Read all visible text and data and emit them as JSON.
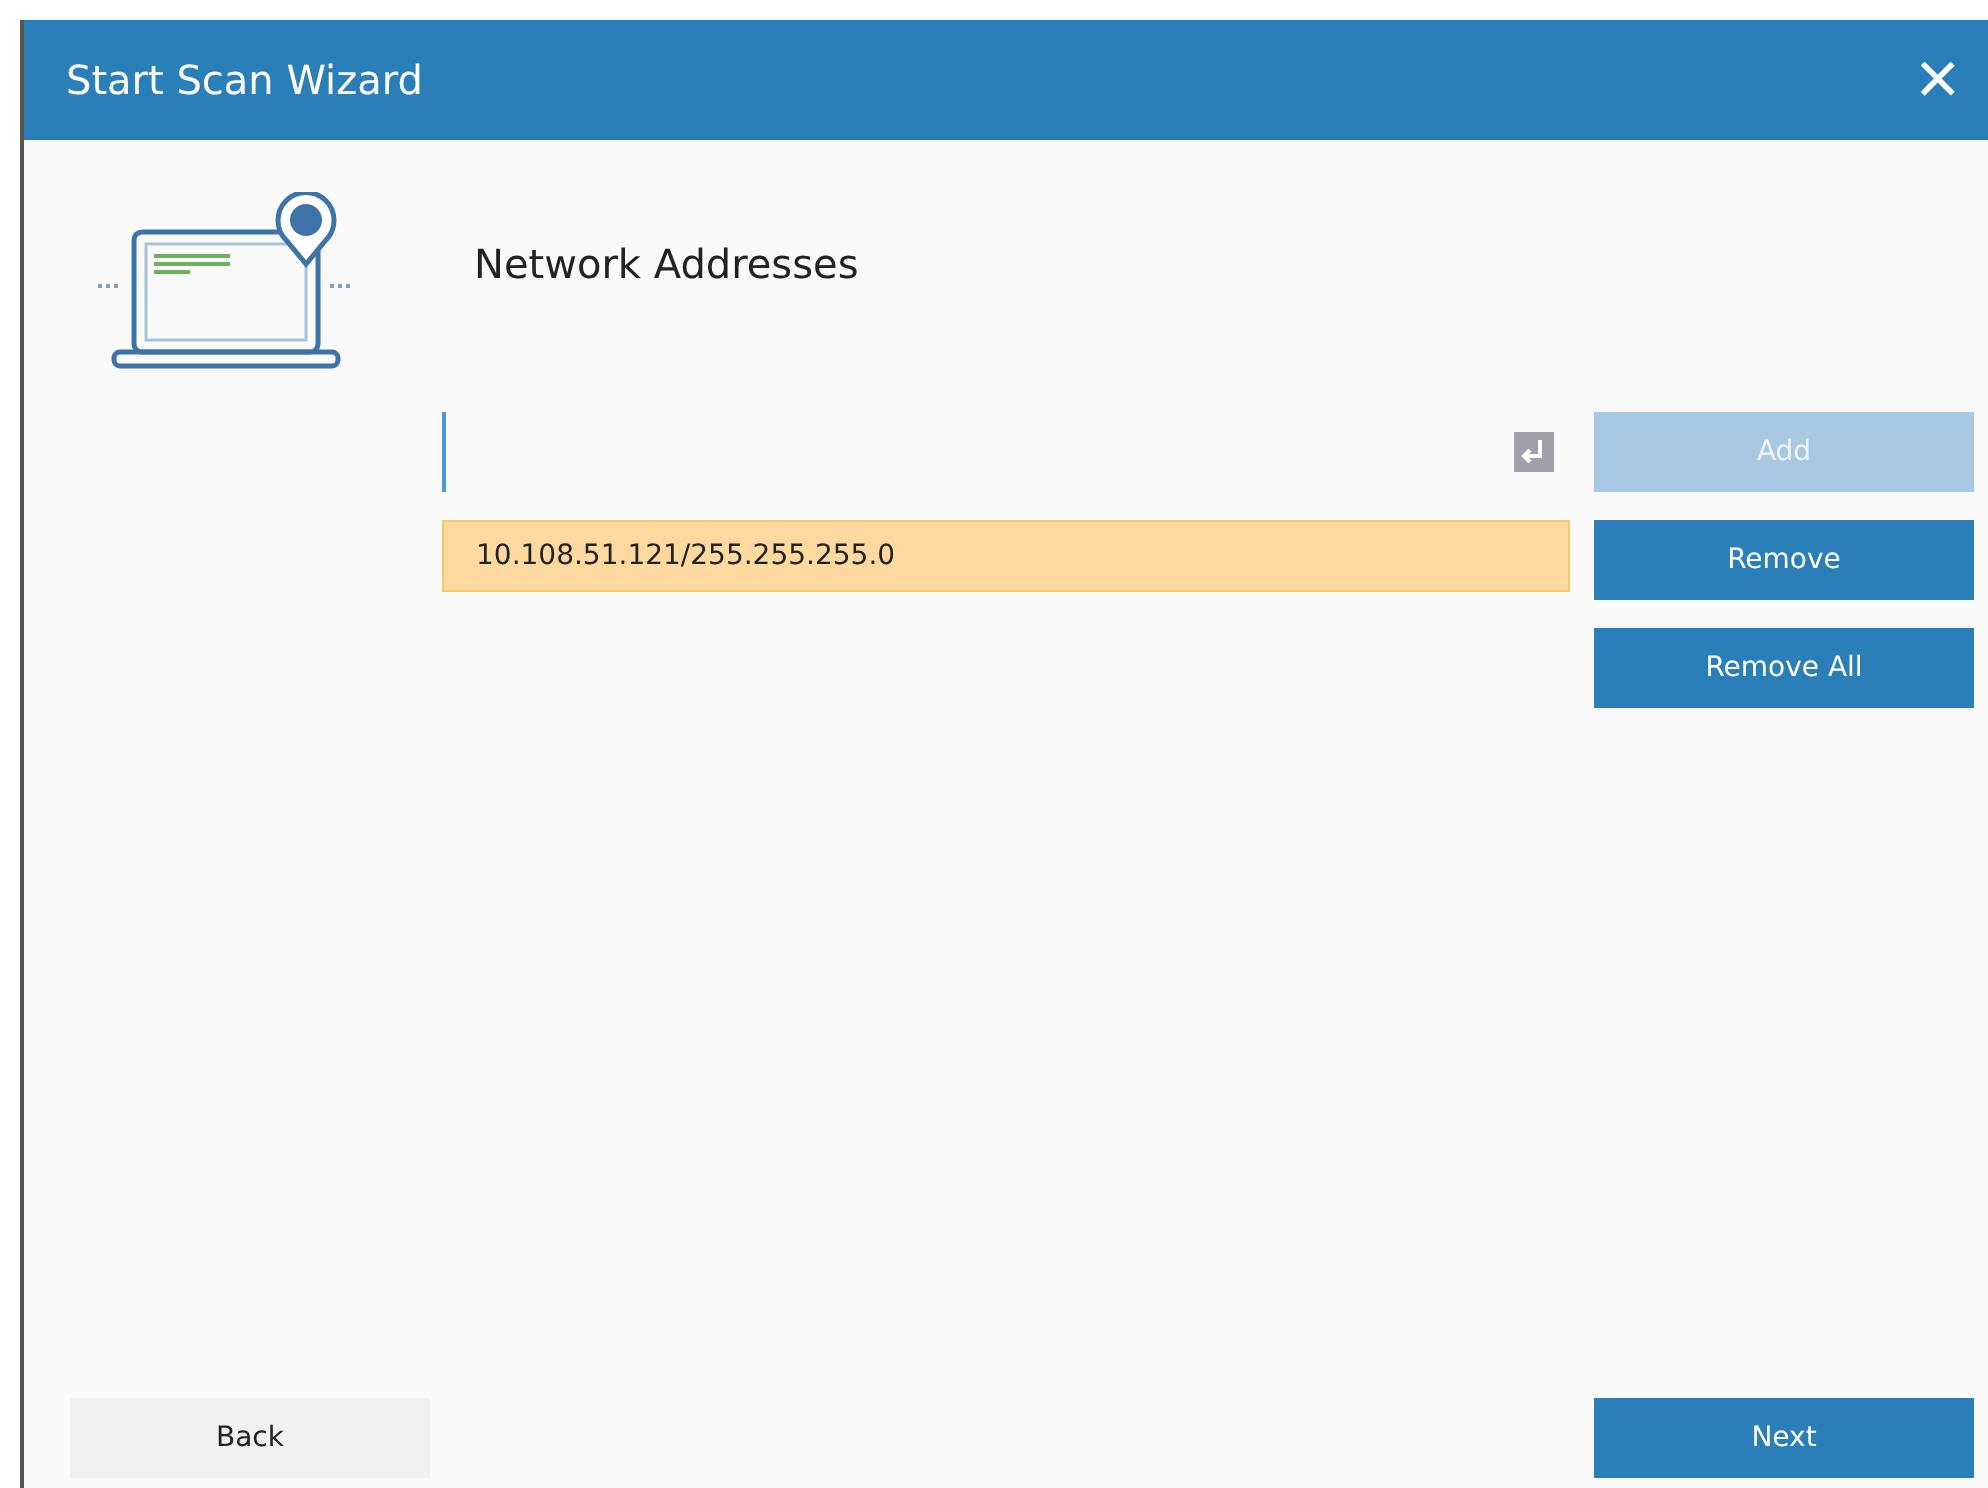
{
  "window": {
    "title": "Start Scan Wizard",
    "close": "×"
  },
  "heading": "Network Addresses",
  "address_field": {
    "focused": true
  },
  "addresses": [
    {
      "text": "10.108.51.121/255.255.255.0",
      "selected": true
    }
  ],
  "side_buttons": [
    {
      "label": "Add",
      "disabled": true
    },
    {
      "label": "Remove",
      "disabled": false
    },
    {
      "label": "Remove All",
      "disabled": false
    }
  ],
  "footer": {
    "back": "Back",
    "next": "Next"
  }
}
